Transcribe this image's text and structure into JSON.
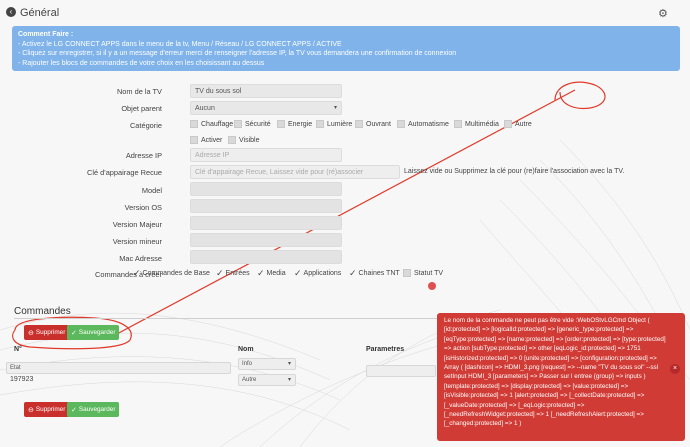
{
  "header": {
    "title": "Général"
  },
  "info": {
    "title": "Comment Faire :",
    "lines": [
      "- Activez le LG CONNECT APPS dans le menu de la tv, Menu / Réseau / LG CONNECT APPS / ACTIVE",
      "- Cliquez sur enregistrer, si il y a un message d'erreur merci de renseigner l'adresse IP, la TV vous demandera une confirmation de connexion",
      "- Rajouter les blocs de commandes de votre choix en les choisissant au dessus"
    ]
  },
  "form": {
    "name_label": "Nom de la TV",
    "name_value": "TV du sous sol",
    "parent_label": "Objet parent",
    "parent_value": "Aucun",
    "category_label": "Catégorie",
    "categories": [
      "Chauffage",
      "Sécurité",
      "Energie",
      "Lumière",
      "Ouvrant",
      "Automatisme",
      "Multimédia",
      "Autre"
    ],
    "activate_label": "Activer",
    "visible_label": "Visible",
    "ip_label": "Adresse IP",
    "ip_placeholder": "Adresse IP",
    "key_label": "Clé d'appairage Recue",
    "key_placeholder": "Clé d'appairage Recue, Laissez vide pour (ré)associer",
    "key_hint": "Laissez vide ou Supprimez la clé pour (re)faire l'association avec la TV.",
    "model_label": "Model",
    "os_label": "Version OS",
    "major_label": "Version Majeur",
    "minor_label": "Version mineur",
    "mac_label": "Mac Adresse",
    "create_label": "Commandes à créer",
    "create_options": [
      "Commandes de Base",
      "Entrées",
      "Media",
      "Applications",
      "Chaines TNT",
      "Statut TV"
    ]
  },
  "commands": {
    "title": "Commandes",
    "delete_label": "Supprimer",
    "save_label": "Sauvegarder",
    "col_num": "N°",
    "col_name": "Nom",
    "col_params": "Parametres",
    "row_name": "Etat",
    "row_id": "197923",
    "row_type": "Info",
    "row_subtype": "Autre"
  },
  "error": {
    "text": "Le nom de la commande ne peut pas être vide :WebOStvLGCmd Object ( [id:protected] => [logicalId:protected] => [generic_type:protected] => [eqType:protected] => [name:protected] => [order:protected] => [type:protected] => action [subType:protected] => other [eqLogic_id:protected] => 1751 [isHistorized:protected] => 0 [unite:protected] => [configuration:protected] => Array ( [dashicon] => HDMI_3.png [request] => --name \"TV du sous sol\" --ssl setInput HDMI_3 [parameters] => Passer sur l entree {group} => inputs ) [template:protected] => [display:protected] => [value:protected] => [isVisible:protected] => 1 [alert:protected] => [_collectDate:protected] => [_valueDate:protected] => [_eqLogic:protected] => [_needRefreshWidget:protected] => 1 [_needRefreshAlert:protected] => [_changed:protected] => 1 )"
  },
  "colors": {
    "info_bg": "#7fb3ea",
    "error_bg": "#d13b35",
    "danger": "#c9302c",
    "success": "#5cb85c",
    "annotation": "#e03a2a"
  }
}
